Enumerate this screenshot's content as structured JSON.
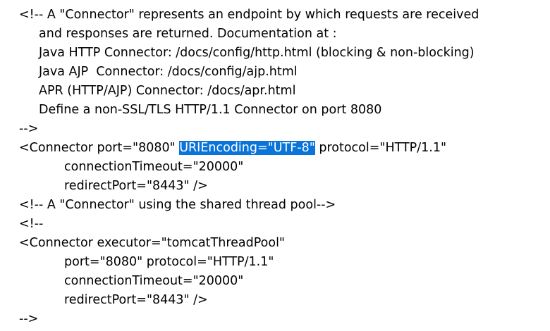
{
  "editor": {
    "lines": [
      {
        "text": "<!-- A \"Connector\" represents an endpoint by which requests are received"
      },
      {
        "text": "and responses are returned. Documentation at :"
      },
      {
        "text": "Java HTTP Connector: /docs/config/http.html (blocking & non-blocking)"
      },
      {
        "text": "Java AJP  Connector: /docs/config/ajp.html"
      },
      {
        "text": "APR (HTTP/AJP) Connector: /docs/apr.html"
      },
      {
        "text": "Define a non-SSL/TLS HTTP/1.1 Connector on port 8080"
      },
      {
        "text": "-->"
      },
      {
        "before": "<Connector port=\"8080\" ",
        "selected": "URIEncoding=\"UTF-8\"",
        "after": " protocol=\"HTTP/1.1\""
      },
      {
        "text": "connectionTimeout=\"20000\""
      },
      {
        "text": "redirectPort=\"8443\" />"
      },
      {
        "text": "<!-- A \"Connector\" using the shared thread pool-->"
      },
      {
        "text": "<!--"
      },
      {
        "text": "<Connector executor=\"tomcatThreadPool\""
      },
      {
        "text": "port=\"8080\" protocol=\"HTTP/1.1\""
      },
      {
        "text": "connectionTimeout=\"20000\""
      },
      {
        "text": "redirectPort=\"8443\" />"
      },
      {
        "text": "-->"
      }
    ],
    "selection_color": "#0a74d9"
  }
}
